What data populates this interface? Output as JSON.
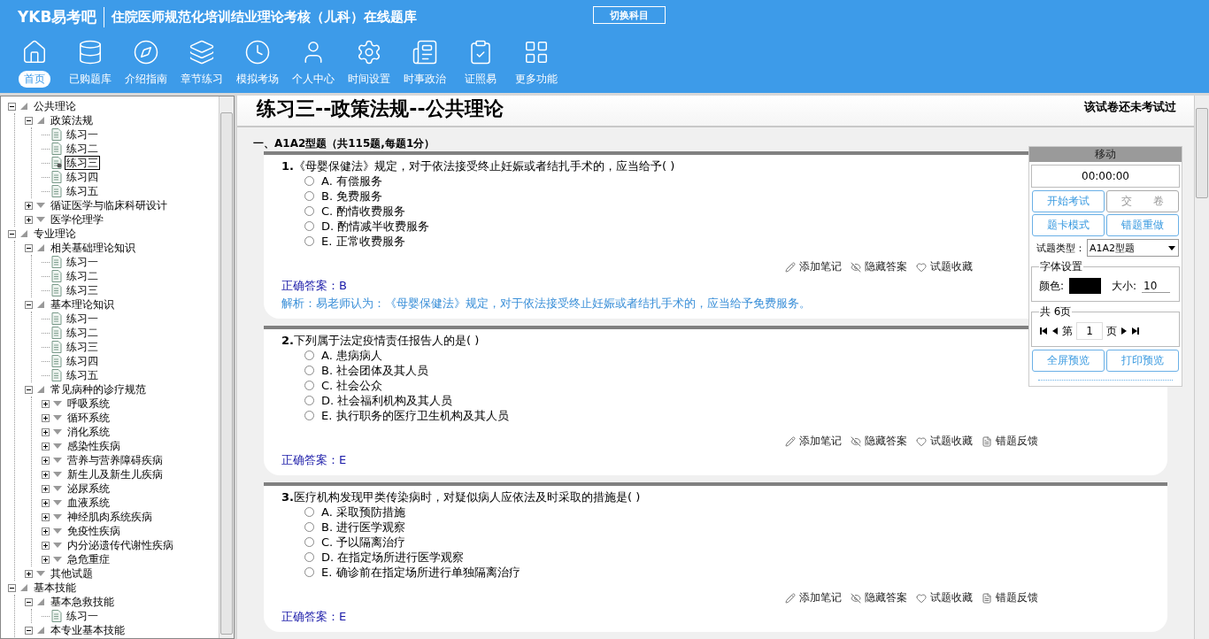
{
  "header": {
    "logo": "YKB易考吧",
    "title": "住院医师规范化培训结业理论考核（儿科）在线题库",
    "switch_button": "切换科目"
  },
  "toolbar": [
    {
      "label": "首页",
      "selected": true
    },
    {
      "label": "已购题库",
      "selected": false
    },
    {
      "label": "介绍指南",
      "selected": false
    },
    {
      "label": "章节练习",
      "selected": false
    },
    {
      "label": "模拟考场",
      "selected": false
    },
    {
      "label": "个人中心",
      "selected": false
    },
    {
      "label": "时间设置",
      "selected": false
    },
    {
      "label": "时事政治",
      "selected": false
    },
    {
      "label": "证照易",
      "selected": false
    },
    {
      "label": "更多功能",
      "selected": false
    }
  ],
  "tree": [
    {
      "label": "公共理论",
      "expanded": true,
      "children": [
        {
          "label": "政策法规",
          "expanded": true,
          "children": [
            {
              "label": "练习一",
              "selected": false
            },
            {
              "label": "练习二",
              "selected": false
            },
            {
              "label": "练习三",
              "selected": true
            },
            {
              "label": "练习四",
              "selected": false
            },
            {
              "label": "练习五",
              "selected": false
            }
          ]
        },
        {
          "label": "循证医学与临床科研设计",
          "expanded": false
        },
        {
          "label": "医学伦理学",
          "expanded": false
        }
      ]
    },
    {
      "label": "专业理论",
      "expanded": true,
      "children": [
        {
          "label": "相关基础理论知识",
          "expanded": true,
          "children": [
            {
              "label": "练习一",
              "selected": false
            },
            {
              "label": "练习二",
              "selected": false
            },
            {
              "label": "练习三",
              "selected": false
            }
          ]
        },
        {
          "label": "基本理论知识",
          "expanded": true,
          "children": [
            {
              "label": "练习一",
              "selected": false
            },
            {
              "label": "练习二",
              "selected": false
            },
            {
              "label": "练习三",
              "selected": false
            },
            {
              "label": "练习四",
              "selected": false
            },
            {
              "label": "练习五",
              "selected": false
            }
          ]
        },
        {
          "label": "常见病种的诊疗规范",
          "expanded": true,
          "children": [
            {
              "label": "呼吸系统",
              "expanded": false
            },
            {
              "label": "循环系统",
              "expanded": false
            },
            {
              "label": "消化系统",
              "expanded": false
            },
            {
              "label": "感染性疾病",
              "expanded": false
            },
            {
              "label": "营养与营养障碍疾病",
              "expanded": false
            },
            {
              "label": "新生儿及新生儿疾病",
              "expanded": false
            },
            {
              "label": "泌尿系统",
              "expanded": false
            },
            {
              "label": "血液系统",
              "expanded": false
            },
            {
              "label": "神经肌肉系统疾病",
              "expanded": false
            },
            {
              "label": "免疫性疾病",
              "expanded": false
            },
            {
              "label": "内分泌遗传代谢性疾病",
              "expanded": false
            },
            {
              "label": "急危重症",
              "expanded": false
            }
          ]
        },
        {
          "label": "其他试题",
          "expanded": false
        }
      ]
    },
    {
      "label": "基本技能",
      "expanded": true,
      "children": [
        {
          "label": "基本急救技能",
          "expanded": true,
          "children": [
            {
              "label": "练习一",
              "selected": false
            }
          ]
        },
        {
          "label": "本专业基本技能",
          "expanded": true
        }
      ]
    }
  ],
  "exam": {
    "title": "练习三--政策法规--公共理论",
    "status": "该试卷还未考试过",
    "section": "一、A1A2型题（共115题,每题1分）",
    "questions": [
      {
        "number": "1.",
        "stem": "《母婴保健法》规定，对于依法接受终止妊娠或者结扎手术的，应当给予( )",
        "options": [
          {
            "letter": "A.",
            "text": "有偿服务",
            "selected": false
          },
          {
            "letter": "B.",
            "text": "免费服务",
            "selected": false
          },
          {
            "letter": "C.",
            "text": "酌情收费服务",
            "selected": false
          },
          {
            "letter": "D.",
            "text": "酌情减半收费服务",
            "selected": false
          },
          {
            "letter": "E.",
            "text": "正常收费服务",
            "selected": false
          }
        ],
        "actions": [
          "添加笔记",
          "隐藏答案",
          "试题收藏"
        ],
        "answer": "正确答案：B",
        "explanation": "解析：易老师认为：《母婴保健法》规定，对于依法接受终止妊娠或者结扎手术的，应当给予免费服务。"
      },
      {
        "number": "2.",
        "stem": "下列属于法定疫情责任报告人的是( )",
        "options": [
          {
            "letter": "A.",
            "text": "患病病人",
            "selected": false
          },
          {
            "letter": "B.",
            "text": "社会团体及其人员",
            "selected": false
          },
          {
            "letter": "C.",
            "text": "社会公众",
            "selected": false
          },
          {
            "letter": "D.",
            "text": "社会福利机构及其人员",
            "selected": false
          },
          {
            "letter": "E.",
            "text": "执行职务的医疗卫生机构及其人员",
            "selected": false
          }
        ],
        "actions": [
          "添加笔记",
          "隐藏答案",
          "试题收藏",
          "错题反馈"
        ],
        "answer": "正确答案：E"
      },
      {
        "number": "3.",
        "stem": "医疗机构发现甲类传染病时，对疑似病人应依法及时采取的措施是( )",
        "options": [
          {
            "letter": "A.",
            "text": "采取预防措施",
            "selected": false
          },
          {
            "letter": "B.",
            "text": "进行医学观察",
            "selected": false
          },
          {
            "letter": "C.",
            "text": "予以隔离治疗",
            "selected": false
          },
          {
            "letter": "D.",
            "text": "在指定场所进行医学观察",
            "selected": false
          },
          {
            "letter": "E.",
            "text": "确诊前在指定场所进行单独隔离治疗",
            "selected": false
          }
        ],
        "actions": [
          "添加笔记",
          "隐藏答案",
          "试题收藏",
          "错题反馈"
        ],
        "answer": "正确答案：E"
      }
    ]
  },
  "panel": {
    "move_title": "移动",
    "timer": "00:00:00",
    "buttons": [
      {
        "label": "开始考试",
        "disabled": false
      },
      {
        "label": "交　　卷",
        "disabled": true
      },
      {
        "label": "题卡模式",
        "disabled": false
      },
      {
        "label": "错题重做",
        "disabled": false
      }
    ],
    "type_label": "试题类型：",
    "type_value": "A1A2型题",
    "font_group": "字体设置",
    "color_label": "颜色:",
    "color": "#000000",
    "size_label": "大小:",
    "size": "10",
    "pages_group": "共 6页",
    "page_prefix": "第",
    "page": "1",
    "page_suffix": "页",
    "preview_buttons": [
      "全屏预览",
      "打印预览"
    ]
  }
}
